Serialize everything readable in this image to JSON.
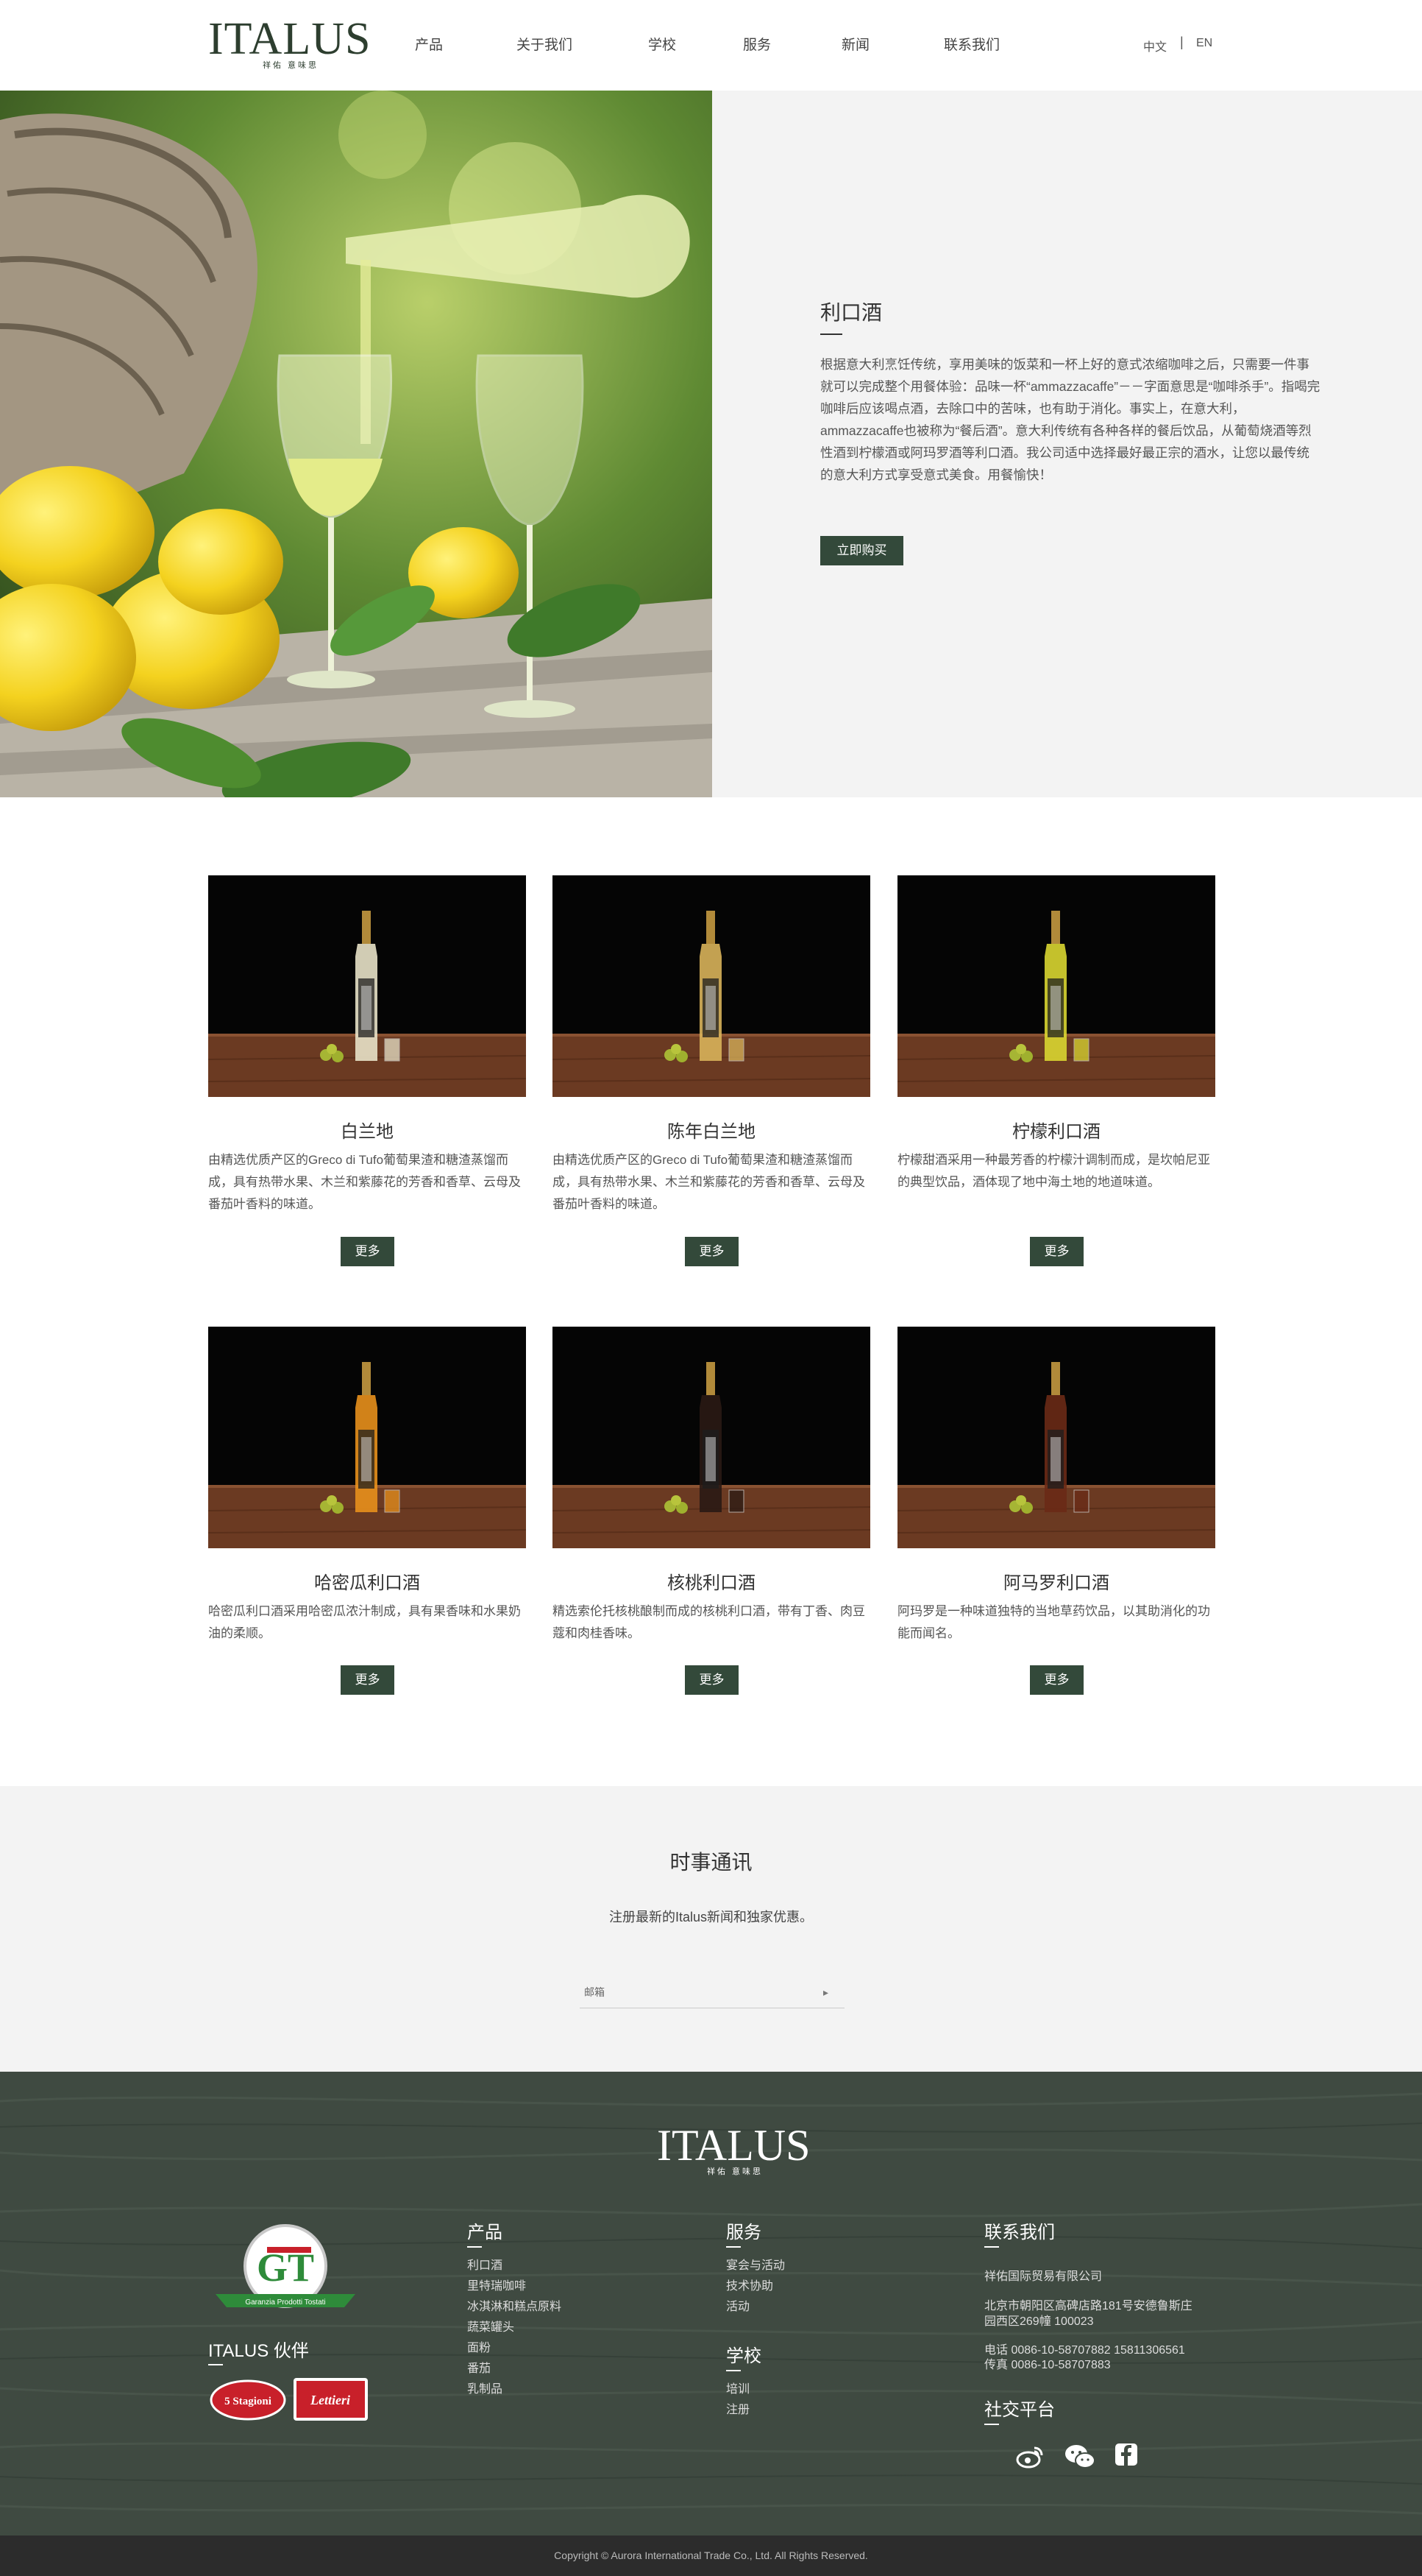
{
  "header": {
    "logo_text": "ITALUS",
    "logo_sub": "祥佑 意味思",
    "nav": [
      "产品",
      "关于我们",
      "学校",
      "服务",
      "新闻",
      "联系我们"
    ],
    "lang_zh": "中文",
    "lang_sep": "|",
    "lang_en": "EN"
  },
  "hero": {
    "title": "利口酒",
    "text": "根据意大利烹饪传统，享用美味的饭菜和一杯上好的意式浓缩咖啡之后，只需要一件事就可以完成整个用餐体验：品味一杯“ammazzacaffe”－－字面意思是“咖啡杀手”。指喝完咖啡后应该喝点酒，去除口中的苦味，也有助于消化。事实上，在意大利，ammazzacaffe也被称为“餐后酒”。意大利传统有各种各样的餐后饮品，从葡萄烧酒等烈性酒到柠檬酒或阿玛罗酒等利口酒。我公司适中选择最好最正宗的酒水，让您以最传统的意大利方式享受意式美食。用餐愉快！",
    "button": "立即购买"
  },
  "products": [
    {
      "title": "白兰地",
      "desc": "由精选优质产区的Greco di Tufo葡萄果渣和糖渣蒸馏而成，具有热带水果、木兰和紫藤花的芳香和香草、云母及番茄叶香料的味道。",
      "button": "更多",
      "liquid": "#e8e2c8"
    },
    {
      "title": "陈年白兰地",
      "desc": "由精选优质产区的Greco di Tufo葡萄果渣和糖渣蒸馏而成，具有热带水果、木兰和紫藤花的芳香和香草、云母及番茄叶香料的味道。",
      "button": "更多",
      "liquid": "#d8b25a"
    },
    {
      "title": "柠檬利口酒",
      "desc": "柠檬甜酒采用一种最芳香的柠檬汁调制而成，是坎帕尼亚的典型饮品，酒体现了地中海土地的地道味道。",
      "button": "更多",
      "liquid": "#d9d631"
    },
    {
      "title": "哈密瓜利口酒",
      "desc": "哈密瓜利口酒采用哈密瓜浓汁制成，具有果香味和水果奶油的柔顺。",
      "button": "更多",
      "liquid": "#e8901c"
    },
    {
      "title": "核桃利口酒",
      "desc": "精选索伦托核桃酿制而成的核桃利口酒，带有丁香、肉豆蔻和肉桂香味。",
      "button": "更多",
      "liquid": "#2a1a14"
    },
    {
      "title": "阿马罗利口酒",
      "desc": "阿玛罗是一种味道独特的当地草药饮品，以其助消化的功能而闻名。",
      "button": "更多",
      "liquid": "#6a2a16"
    }
  ],
  "newsletter": {
    "title": "时事通讯",
    "subtitle": "注册最新的Italus新闻和独家优惠。",
    "placeholder": "邮箱",
    "arrow": "▸"
  },
  "footer": {
    "logo_text": "ITALUS",
    "logo_sub": "祥佑 意味思",
    "partners_title": "ITALUS 伙伴",
    "partner_gt_initials": "GT",
    "partner_gt_text": "Garanzia Prodotti Tostati",
    "partner_5s_text": "5 Stagioni",
    "partner_lettieri_text": "Lettieri",
    "products_title": "产品",
    "products": [
      "利口酒",
      "里特瑞咖啡",
      "冰淇淋和糕点原料",
      "蔬菜罐头",
      "面粉",
      "番茄",
      "乳制品"
    ],
    "services_title": "服务",
    "services": [
      "宴会与活动",
      "技术协助",
      "活动"
    ],
    "school_title": "学校",
    "school": [
      "培训",
      "注册"
    ],
    "contact_title": "联系我们",
    "company": "祥佑国际贸易有限公司",
    "address1": "北京市朝阳区高碑店路181号安德鲁斯庄",
    "address2": "园西区269幢 100023",
    "phone": "电话 0086-10-58707882 15811306561",
    "fax": "传真 0086-10-58707883",
    "social_title": "社交平台",
    "social_icons": [
      "weibo-icon",
      "wechat-icon",
      "facebook-icon"
    ]
  },
  "copyright": "Copyright © Aurora International Trade Co., Ltd. All Rights Reserved.",
  "colors": {
    "brand_green": "#33493a",
    "footer_bg": "#3f4a41"
  }
}
